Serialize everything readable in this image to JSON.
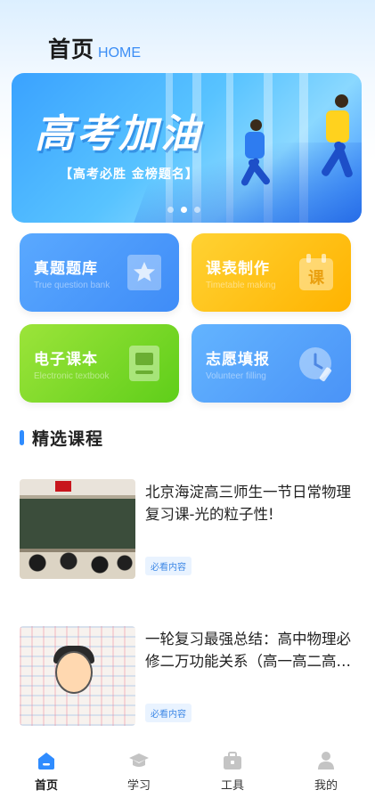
{
  "header": {
    "title": "首页",
    "subtitle": "HOME"
  },
  "banner": {
    "headline": "高考加油",
    "slogan": "【高考必胜 金榜题名】",
    "active_slide": 2,
    "slide_count": 3
  },
  "tiles": [
    {
      "title": "真题题库",
      "subtitle": "True question bank",
      "icon": "star-book-icon",
      "color": "#4d9bfb"
    },
    {
      "title": "课表制作",
      "subtitle": "Timetable making",
      "icon": "calendar-icon",
      "color": "#ffc31a"
    },
    {
      "title": "电子课本",
      "subtitle": "Electronic textbook",
      "icon": "textbook-icon",
      "color": "#7fd92a"
    },
    {
      "title": "志愿填报",
      "subtitle": "Volunteer filling",
      "icon": "clock-edit-icon",
      "color": "#56a2fa"
    }
  ],
  "section": {
    "title": "精选课程"
  },
  "courses": [
    {
      "title": "北京海淀高三师生一节日常物理复习课-光的粒子性!",
      "tag": "必看内容"
    },
    {
      "title": "一轮复习最强总结：高中物理必修二万功能关系（高一高二高三）",
      "tag": "必看内容"
    }
  ],
  "tabbar": {
    "items": [
      {
        "label": "首页",
        "icon": "home-icon",
        "active": true
      },
      {
        "label": "学习",
        "icon": "graduation-cap-icon",
        "active": false
      },
      {
        "label": "工具",
        "icon": "toolbox-icon",
        "active": false
      },
      {
        "label": "我的",
        "icon": "user-icon",
        "active": false
      }
    ]
  },
  "colors": {
    "accent": "#2f8cff",
    "tab_active": "#2f8cff",
    "tab_inactive": "#c4c4c4"
  }
}
